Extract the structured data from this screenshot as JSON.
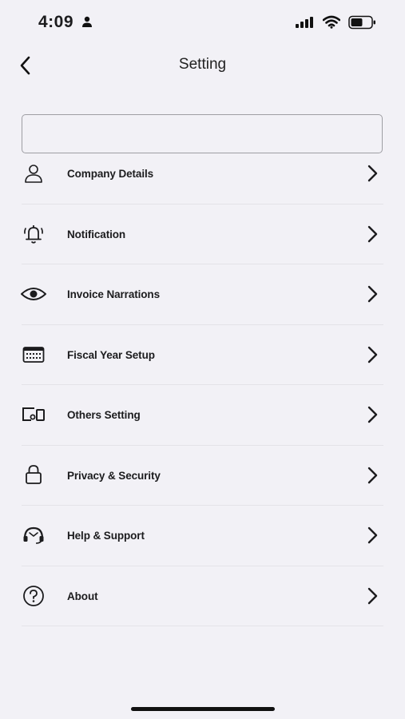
{
  "status_bar": {
    "time": "4:09"
  },
  "header": {
    "title": "Setting"
  },
  "search": {
    "value": "",
    "placeholder": ""
  },
  "menu": {
    "items": [
      {
        "label": "Company Details",
        "icon": "person-icon"
      },
      {
        "label": "Notification",
        "icon": "bell-icon"
      },
      {
        "label": "Invoice Narrations",
        "icon": "eye-icon"
      },
      {
        "label": "Fiscal Year Setup",
        "icon": "calendar-icon"
      },
      {
        "label": "Others Setting",
        "icon": "devices-icon"
      },
      {
        "label": "Privacy & Security",
        "icon": "lock-icon"
      },
      {
        "label": "Help & Support",
        "icon": "support-icon"
      },
      {
        "label": "About",
        "icon": "question-icon"
      }
    ]
  }
}
